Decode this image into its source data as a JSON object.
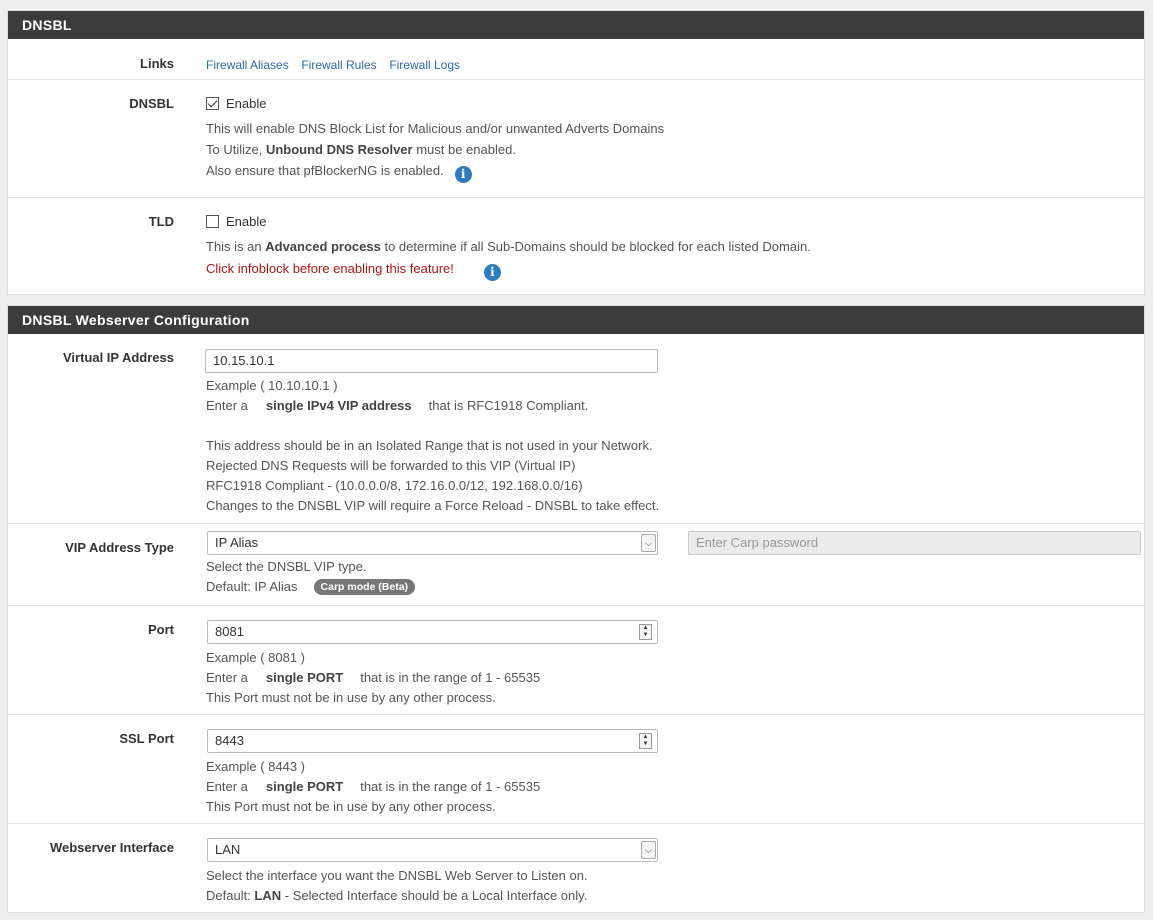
{
  "dnsbl_panel": {
    "title": "DNSBL",
    "links": {
      "label": "Links",
      "items": [
        "Firewall Aliases",
        "Firewall Rules",
        "Firewall Logs"
      ]
    },
    "dnsbl": {
      "label": "DNSBL",
      "checkbox_label": "Enable",
      "checked": true,
      "help1": "This will enable DNS Block List for Malicious and/or unwanted Adverts Domains",
      "help2_pre": "To Utilize, ",
      "help2_bold": "Unbound DNS Resolver",
      "help2_post": " must be enabled.",
      "help3": "Also ensure that pfBlockerNG is enabled."
    },
    "tld": {
      "label": "TLD",
      "checkbox_label": "Enable",
      "checked": false,
      "help1_pre": "This is an ",
      "help1_bold": "Advanced process",
      "help1_post": " to determine if all Sub-Domains should be blocked for each listed Domain.",
      "warning": "Click infoblock before enabling this feature!"
    }
  },
  "webserver_panel": {
    "title": "DNSBL Webserver Configuration",
    "vip": {
      "label": "Virtual IP Address",
      "value": "10.15.10.1",
      "help1": "Example ( 10.10.10.1 )",
      "help2_pre": "Enter a",
      "help2_bold": "single IPv4 VIP address",
      "help2_post": "that is RFC1918 Compliant.",
      "help3": "This address should be in an Isolated Range that is not used in your Network.",
      "help4": "Rejected DNS Requests will be forwarded to this VIP (Virtual IP)",
      "help5": "RFC1918 Compliant - (10.0.0.0/8, 172.16.0.0/12, 192.168.0.0/16)",
      "help6": "Changes to the DNSBL VIP will require a Force Reload - DNSBL to take effect."
    },
    "vip_type": {
      "label": "VIP Address Type",
      "value": "IP Alias",
      "carp_placeholder": "Enter Carp password",
      "help1": "Select the DNSBL VIP type.",
      "help2": "Default: IP Alias",
      "badge": "Carp mode (Beta)"
    },
    "port": {
      "label": "Port",
      "value": "8081",
      "help1": "Example ( 8081 )",
      "help2_pre": "Enter a",
      "help2_bold": "single PORT",
      "help2_post": "that is in the range of 1 - 65535",
      "help3": "This Port must not be in use by any other process."
    },
    "ssl_port": {
      "label": "SSL Port",
      "value": "8443",
      "help1": "Example ( 8443 )",
      "help2_pre": "Enter a",
      "help2_bold": "single PORT",
      "help2_post": "that is in the range of 1 - 65535",
      "help3": "This Port must not be in use by any other process."
    },
    "interface": {
      "label": "Webserver Interface",
      "value": "LAN",
      "help1": "Select the interface you want the DNSBL Web Server to Listen on.",
      "help2_pre": "Default: ",
      "help2_bold": "LAN",
      "help2_post": " - Selected Interface should be a Local Interface only."
    }
  }
}
